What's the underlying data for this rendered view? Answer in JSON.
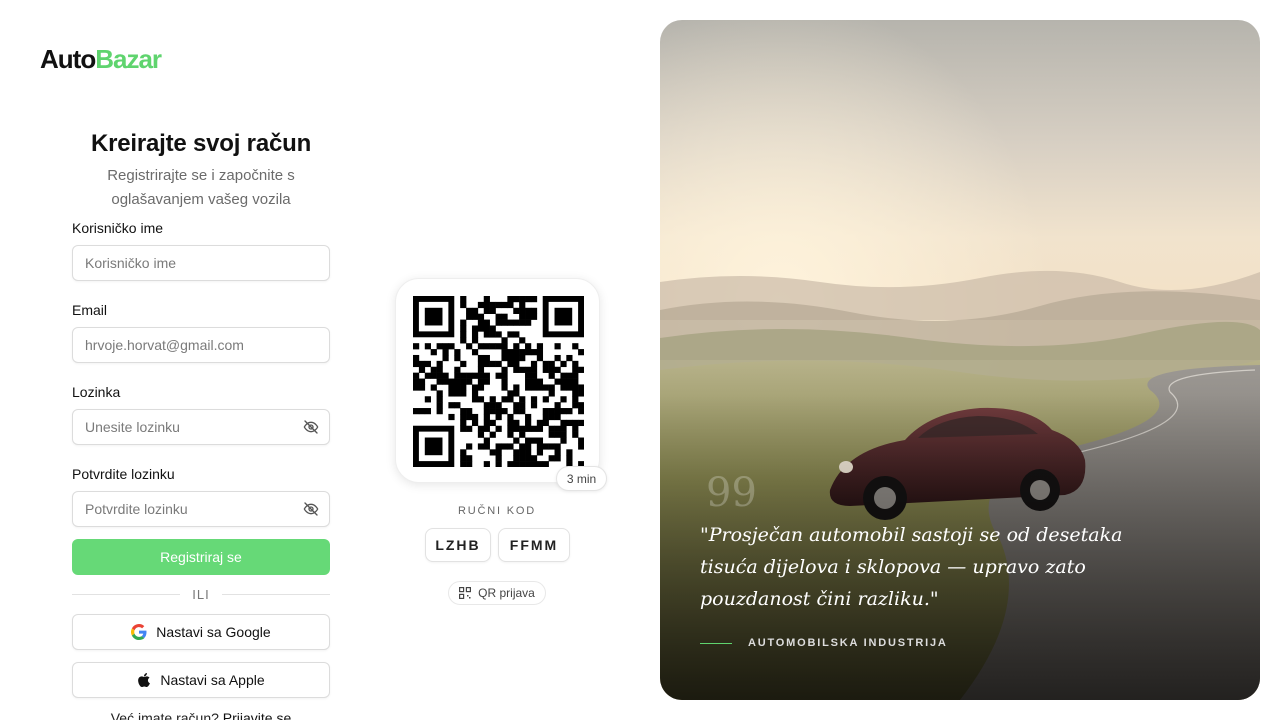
{
  "brand": {
    "part1": "Auto",
    "part2": "Bazar",
    "accent_color": "#5fd46e"
  },
  "form": {
    "title": "Kreirajte svoj račun",
    "subtitle": "Registrirajte se i započnite s oglašavanjem vašeg vozila",
    "username": {
      "label": "Korisničko ime",
      "placeholder": "Korisničko ime",
      "value": ""
    },
    "email": {
      "label": "Email",
      "placeholder": "hrvoje.horvat@gmail.com",
      "value": ""
    },
    "password": {
      "label": "Lozinka",
      "placeholder": "Unesite lozinku",
      "value": ""
    },
    "confirm": {
      "label": "Potvrdite lozinku",
      "placeholder": "Potvrdite lozinku",
      "value": ""
    },
    "submit_label": "Registriraj se",
    "submit_color": "#66d977",
    "divider_label": "ILI",
    "google_label": "Nastavi sa Google",
    "apple_label": "Nastavi sa Apple",
    "login_prompt": "Već imate račun?",
    "login_link": "Prijavite se"
  },
  "qr": {
    "timer": "3 min",
    "manual_title": "RUČNI KOD",
    "codes": [
      "LZHB",
      "FFMM"
    ],
    "qr_login_label": "QR prijava",
    "icon": "qr-code-icon"
  },
  "hero": {
    "quote_mark": "99",
    "quote": "\"Prosječan automobil sastoji se od desetaka tisuća dijelova i sklopova — upravo zato pouzdanost čini razliku.\"",
    "source": "AUTOMOBILSKA INDUSTRIJA"
  }
}
